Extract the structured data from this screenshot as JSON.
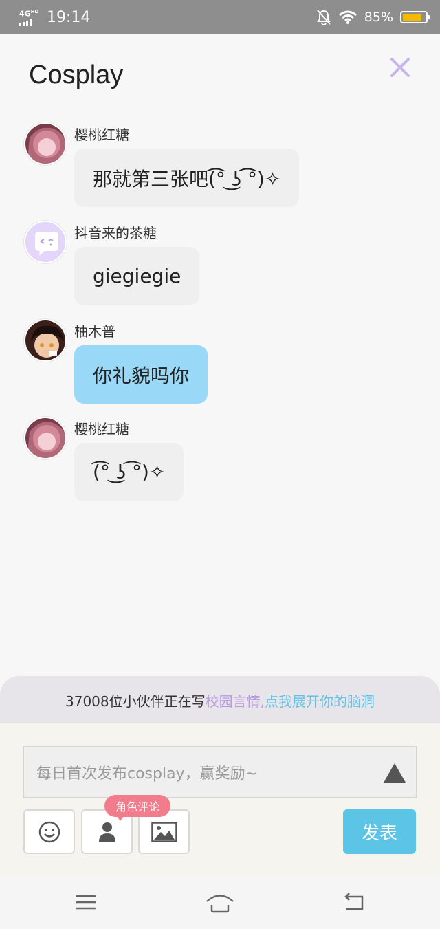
{
  "status_bar": {
    "network": "4G",
    "network_sup": "HD",
    "time": "19:14",
    "battery": "85%",
    "battery_level": 0.85,
    "battery_color": "#f5b800"
  },
  "header": {
    "title": "Cosplay"
  },
  "messages": [
    {
      "user": "樱桃红糖",
      "text": "那就第三张吧(͡° ͜ʖ ͡°)✧",
      "highlight": false,
      "avatar": "pink-anime-avatar"
    },
    {
      "user": "抖音来的茶糖",
      "text": "giegiegie",
      "highlight": false,
      "avatar": "purple-chat-avatar"
    },
    {
      "user": "柚木普",
      "text": "你礼貌吗你",
      "highlight": true,
      "avatar": "anime-boy-avatar"
    },
    {
      "user": "樱桃红糖",
      "text": "(͡° ͜ʖ ͡°)✧",
      "highlight": false,
      "avatar": "pink-anime-avatar"
    }
  ],
  "banner": {
    "prefix": "37008位小伙伴正在写",
    "link1": "校园言情,",
    "link2": "点我展开你的脑洞"
  },
  "composer": {
    "placeholder": "每日首次发布cosplay，赢奖励~",
    "role_badge": "角色评论",
    "publish_label": "发表"
  },
  "colors": {
    "accent": "#5cc5e6",
    "highlight_bubble": "#9ad8f7",
    "badge": "#f07c8c",
    "banner_link": "#b99be0"
  }
}
